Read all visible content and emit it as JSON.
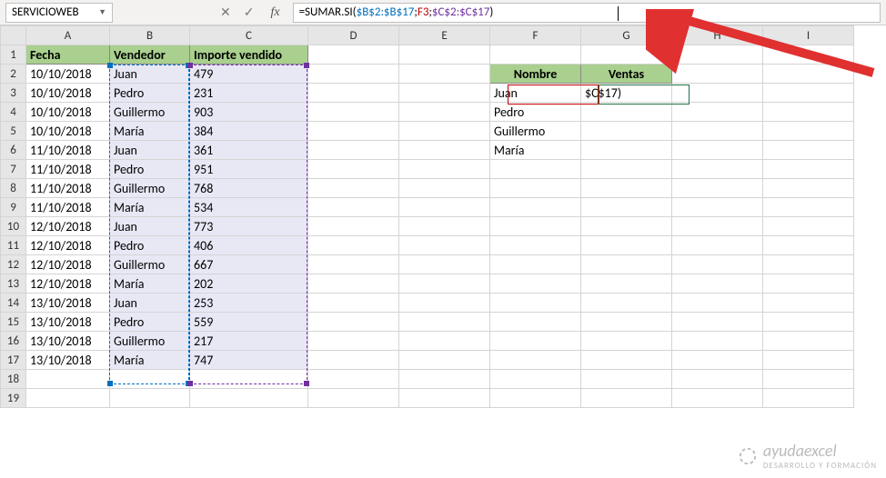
{
  "toolbar": {
    "namebox": "SERVICIOWEB",
    "cancel_glyph": "✕",
    "accept_glyph": "✓",
    "fx_glyph": "fx",
    "formula_parts": {
      "p1": "=SUMAR.SI(",
      "p2": "$B$2:$B$17",
      "p3": ";",
      "p4": "F3",
      "p5": ";",
      "p6": "$C$2:$C$17",
      "p7": ")"
    }
  },
  "columns": [
    "A",
    "B",
    "C",
    "D",
    "E",
    "F",
    "G",
    "H",
    "I"
  ],
  "headers": {
    "a": "Fecha",
    "b": "Vendedor",
    "c": "Importe vendido",
    "f": "Nombre",
    "g": "Ventas"
  },
  "rows": [
    {
      "n": 1
    },
    {
      "n": 2,
      "a": "10/10/2018",
      "b": "Juan",
      "c": 479
    },
    {
      "n": 3,
      "a": "10/10/2018",
      "b": "Pedro",
      "c": 231,
      "f": "Juan",
      "g": "$C$17)"
    },
    {
      "n": 4,
      "a": "10/10/2018",
      "b": "Guillermo",
      "c": 903,
      "f": "Pedro"
    },
    {
      "n": 5,
      "a": "10/10/2018",
      "b": "María",
      "c": 384,
      "f": "Guillermo"
    },
    {
      "n": 6,
      "a": "11/10/2018",
      "b": "Juan",
      "c": 361,
      "f": "María"
    },
    {
      "n": 7,
      "a": "11/10/2018",
      "b": "Pedro",
      "c": 951
    },
    {
      "n": 8,
      "a": "11/10/2018",
      "b": "Guillermo",
      "c": 768
    },
    {
      "n": 9,
      "a": "11/10/2018",
      "b": "María",
      "c": 534
    },
    {
      "n": 10,
      "a": "12/10/2018",
      "b": "Juan",
      "c": 773
    },
    {
      "n": 11,
      "a": "12/10/2018",
      "b": "Pedro",
      "c": 406
    },
    {
      "n": 12,
      "a": "12/10/2018",
      "b": "Guillermo",
      "c": 667
    },
    {
      "n": 13,
      "a": "12/10/2018",
      "b": "María",
      "c": 202
    },
    {
      "n": 14,
      "a": "13/10/2018",
      "b": "Juan",
      "c": 253
    },
    {
      "n": 15,
      "a": "13/10/2018",
      "b": "Pedro",
      "c": 559
    },
    {
      "n": 16,
      "a": "13/10/2018",
      "b": "Guillermo",
      "c": 217
    },
    {
      "n": 17,
      "a": "13/10/2018",
      "b": "María",
      "c": 747
    },
    {
      "n": 18
    },
    {
      "n": 19
    }
  ],
  "watermark": {
    "brand": "ayudaexcel",
    "tag": "DESARROLLO Y FORMACIÓN"
  }
}
